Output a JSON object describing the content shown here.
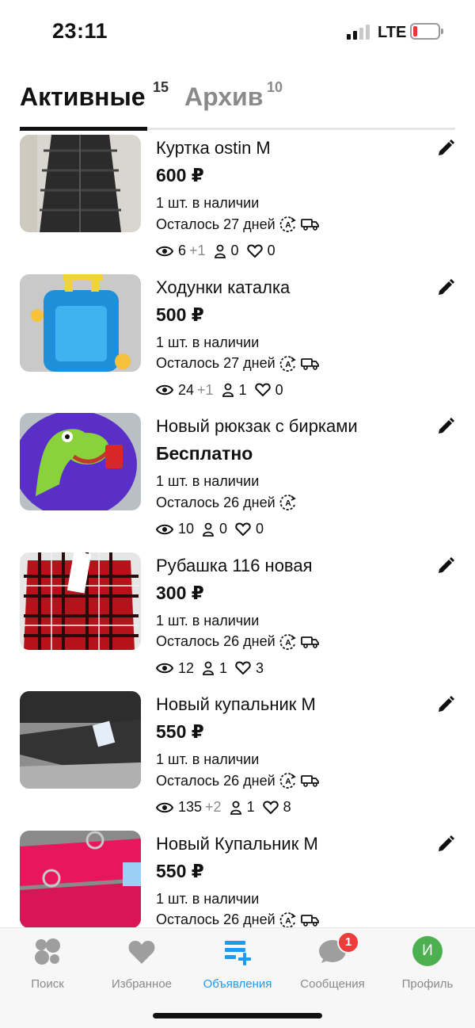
{
  "status_bar": {
    "time": "23:11",
    "network": "LTE",
    "battery_color": "#e53935"
  },
  "tabs": {
    "active": {
      "label": "Активные",
      "count": "15"
    },
    "archive": {
      "label": "Архив",
      "count": "10"
    }
  },
  "listings": [
    {
      "title": "Куртка ostin M",
      "price": "600 ₽",
      "stock": "1 шт. в наличии",
      "remaining": "Осталось 27 дней",
      "delivery": true,
      "views": "6",
      "views_plus": "+1",
      "contacts": "0",
      "favorites": "0",
      "thumb": "black-puffer-jacket"
    },
    {
      "title": "Ходунки каталка",
      "price": "500 ₽",
      "stock": "1 шт. в наличии",
      "remaining": "Осталось 27 дней",
      "delivery": true,
      "views": "24",
      "views_plus": "+1",
      "contacts": "1",
      "favorites": "0",
      "thumb": "blue-walker-toy"
    },
    {
      "title": "Новый рюкзак с бирками",
      "price": "Бесплатно",
      "stock": "1 шт. в наличии",
      "remaining": "Осталось 26 дней",
      "delivery": false,
      "views": "10",
      "views_plus": "",
      "contacts": "0",
      "favorites": "0",
      "thumb": "purple-dragon-backpack"
    },
    {
      "title": "Рубашка 116 новая",
      "price": "300 ₽",
      "stock": "1 шт. в наличии",
      "remaining": "Осталось 26 дней",
      "delivery": true,
      "views": "12",
      "views_plus": "",
      "contacts": "1",
      "favorites": "3",
      "thumb": "red-plaid-shirt"
    },
    {
      "title": "Новый купальник M",
      "price": "550 ₽",
      "stock": "1 шт. в наличии",
      "remaining": "Осталось 26 дней",
      "delivery": true,
      "views": "135",
      "views_plus": "+2",
      "contacts": "1",
      "favorites": "8",
      "thumb": "black-swimsuit"
    },
    {
      "title": "Новый Купальник M",
      "price": "550 ₽",
      "stock": "1 шт. в наличии",
      "remaining": "Осталось 26 дней",
      "delivery": true,
      "views": "",
      "views_plus": "",
      "contacts": "",
      "favorites": "",
      "thumb": "pink-swimsuit"
    }
  ],
  "bottom_nav": {
    "search": "Поиск",
    "favorites": "Избранное",
    "ads": "Объявления",
    "messages": "Сообщения",
    "messages_badge": "1",
    "profile": "Профиль",
    "profile_initial": "И",
    "active_color": "#1e9bf0",
    "profile_color": "#4caf50"
  }
}
